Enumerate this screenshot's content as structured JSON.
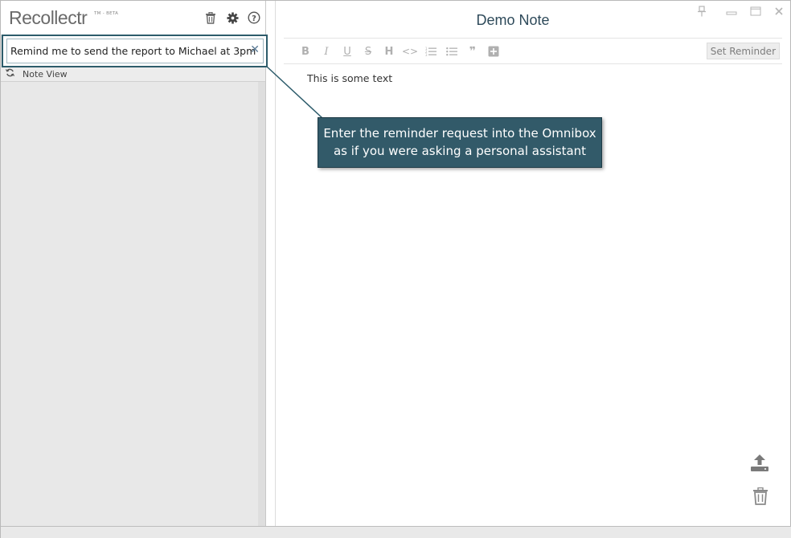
{
  "app": {
    "logo": "Recollectr",
    "logo_sup": "TM - BETA"
  },
  "header_icons": [
    "trash-icon",
    "gear-icon",
    "help-icon"
  ],
  "omnibox": {
    "value": "Remind me to send the report to Michael at 3pm",
    "clear_label": "✕"
  },
  "note_view": {
    "label": "Note View"
  },
  "note": {
    "title": "Demo Note",
    "body": "This is some text"
  },
  "toolbar": {
    "buttons": [
      {
        "name": "bold",
        "glyph": "B"
      },
      {
        "name": "italic",
        "glyph": "I"
      },
      {
        "name": "underline",
        "glyph": "U"
      },
      {
        "name": "strikethrough",
        "glyph": "S"
      },
      {
        "name": "heading",
        "glyph": "H"
      },
      {
        "name": "code",
        "glyph": "<>"
      },
      {
        "name": "ordered-list",
        "glyph": "ol"
      },
      {
        "name": "unordered-list",
        "glyph": "ul"
      },
      {
        "name": "quote",
        "glyph": "❞"
      },
      {
        "name": "insert",
        "glyph": "+"
      }
    ],
    "set_reminder_label": "Set Reminder"
  },
  "tooltip": {
    "line1": "Enter the reminder request into the Omnibox",
    "line2": "as if you were asking a personal assistant"
  },
  "colors": {
    "accent": "#2d5c6b",
    "tooltip_bg": "#325a69",
    "title": "#2e4a5a"
  }
}
